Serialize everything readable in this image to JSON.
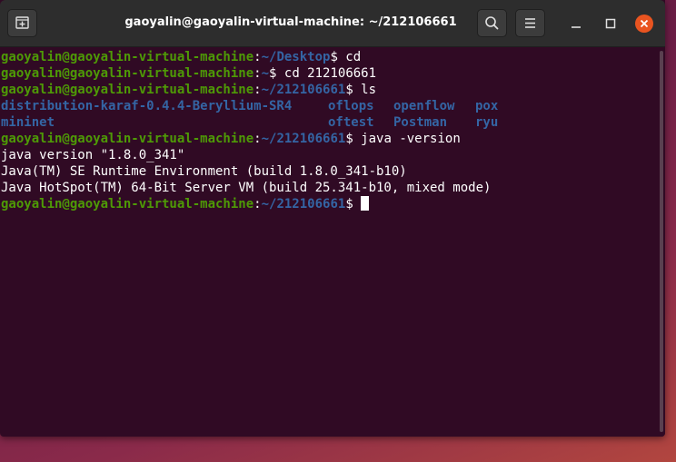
{
  "window": {
    "title": "gaoyalin@gaoyalin-virtual-machine: ~/212106661"
  },
  "icons": {
    "new_tab": "new-tab-icon",
    "search": "search-icon",
    "menu": "hamburger-menu-icon",
    "minimize": "minimize-icon",
    "maximize": "maximize-icon",
    "close": "close-icon"
  },
  "colors": {
    "terminal_bg": "#300a24",
    "user_host": "#4e9a06",
    "path": "#3465a4",
    "directory": "#3465a4",
    "close_button": "#e95420"
  },
  "terminal": {
    "lines": [
      {
        "userhost": "gaoyalin@gaoyalin-virtual-machine",
        "sep": ":",
        "path": "~/Desktop",
        "cmd": "$ cd"
      },
      {
        "userhost": "gaoyalin@gaoyalin-virtual-machine",
        "sep": ":",
        "path": "~",
        "cmd": "$ cd 212106661"
      },
      {
        "userhost": "gaoyalin@gaoyalin-virtual-machine",
        "sep": ":",
        "path": "~/212106661",
        "cmd": "$ ls"
      }
    ],
    "ls_output": {
      "row1": [
        "distribution-karaf-0.4.4-Beryllium-SR4",
        "oflops",
        "openflow",
        "pox"
      ],
      "row2": [
        "mininet",
        "oftest",
        "Postman",
        "ryu"
      ]
    },
    "java_prompt": {
      "userhost": "gaoyalin@gaoyalin-virtual-machine",
      "sep": ":",
      "path": "~/212106661",
      "cmd": "$ java -version"
    },
    "java_output": [
      "java version \"1.8.0_341\"",
      "Java(TM) SE Runtime Environment (build 1.8.0_341-b10)",
      "Java HotSpot(TM) 64-Bit Server VM (build 25.341-b10, mixed mode)"
    ],
    "final_prompt": {
      "userhost": "gaoyalin@gaoyalin-virtual-machine",
      "sep": ":",
      "path": "~/212106661",
      "cmd": "$ "
    }
  }
}
